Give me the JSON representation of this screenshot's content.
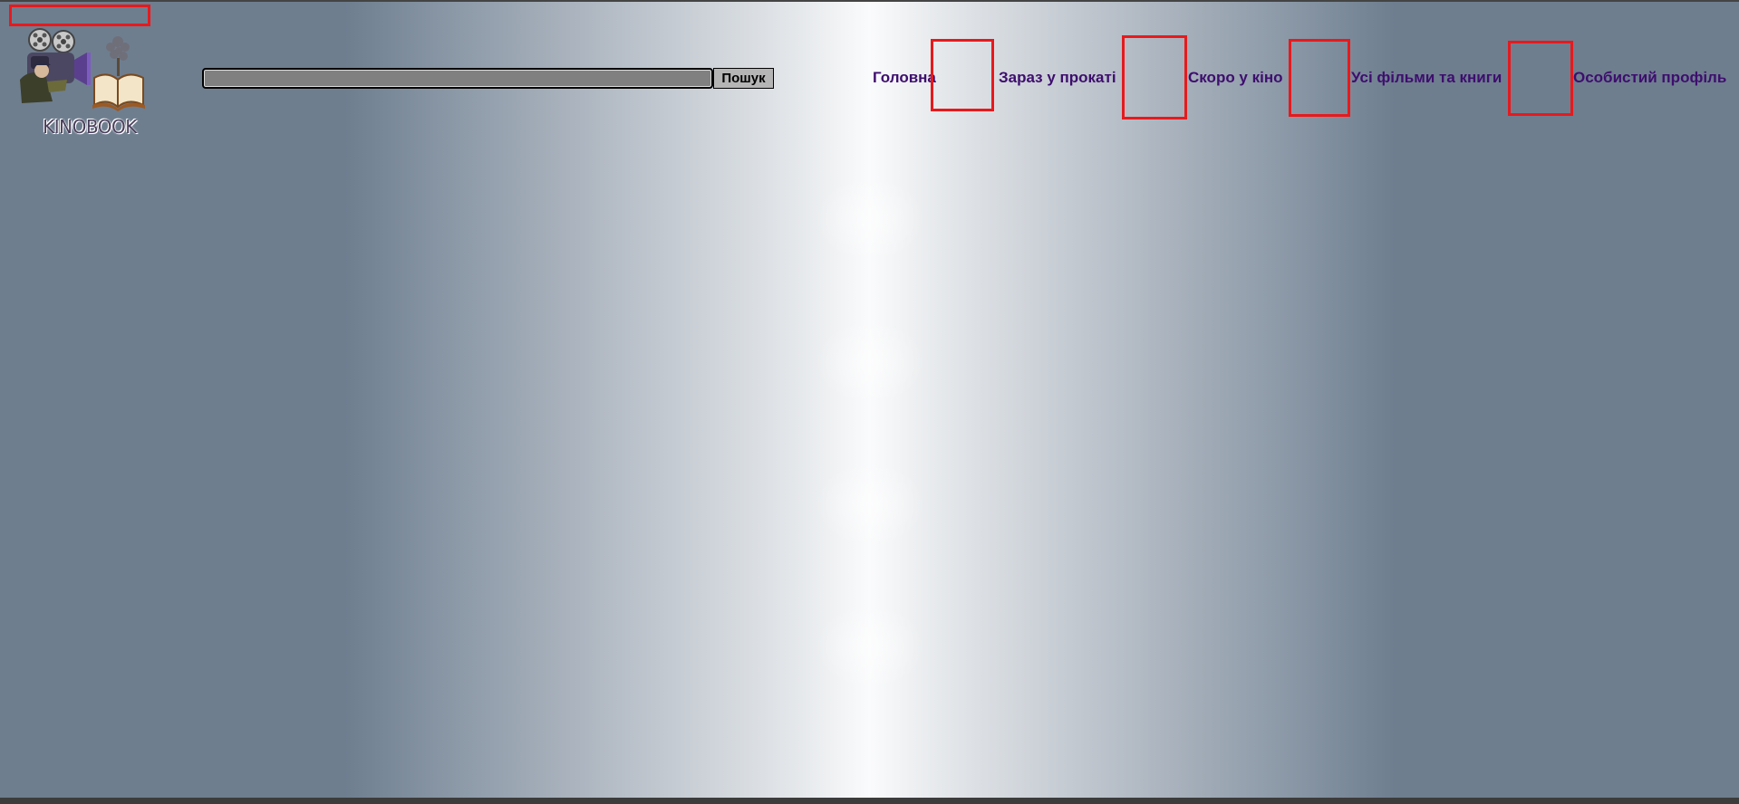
{
  "logo": {
    "text": "KINOBOOK",
    "icon": "film-projector-and-book-logo"
  },
  "search": {
    "value": "",
    "placeholder": "",
    "button_label": "Пошук"
  },
  "nav": {
    "items": [
      {
        "label": "Головна"
      },
      {
        "label": "Зараз у прокаті"
      },
      {
        "label": "Скоро у кіно"
      },
      {
        "label": "Усі фільми та книги"
      },
      {
        "label": "Особистий профіль"
      }
    ]
  },
  "colors": {
    "nav_link": "#3e0e6e",
    "highlight_box": "#e8191c",
    "background_edge": "#6e7e8f",
    "background_center": "#fafbfc"
  }
}
